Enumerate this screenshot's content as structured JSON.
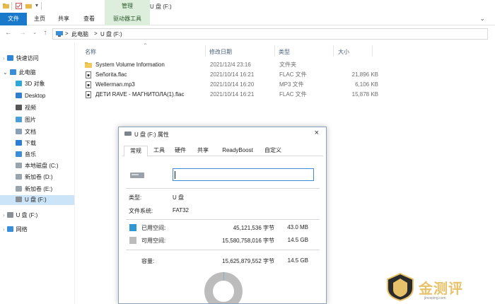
{
  "window": {
    "title": "U 盘 (F:)"
  },
  "ribbon": {
    "contextual_tab": "管理",
    "tabs": [
      {
        "label": "文件"
      },
      {
        "label": "主页"
      },
      {
        "label": "共享"
      },
      {
        "label": "查看"
      },
      {
        "label": "驱动器工具"
      }
    ]
  },
  "address": {
    "path": [
      "此电脑",
      "U 盘 (F:)"
    ],
    "separator": ">"
  },
  "nav_pane": {
    "items": [
      {
        "label": "快速访问",
        "icon": "star-icon"
      },
      {
        "label": "此电脑",
        "icon": "computer-icon"
      },
      {
        "label": "3D 对象",
        "icon": "cube-icon"
      },
      {
        "label": "Desktop",
        "icon": "desktop-icon"
      },
      {
        "label": "视频",
        "icon": "video-icon"
      },
      {
        "label": "图片",
        "icon": "picture-icon"
      },
      {
        "label": "文档",
        "icon": "document-icon"
      },
      {
        "label": "下载",
        "icon": "download-icon"
      },
      {
        "label": "音乐",
        "icon": "music-icon"
      },
      {
        "label": "本地磁盘 (C:)",
        "icon": "drive-icon"
      },
      {
        "label": "新加卷 (D:)",
        "icon": "drive-icon"
      },
      {
        "label": "新加卷 (E:)",
        "icon": "drive-icon"
      },
      {
        "label": "U 盘 (F:)",
        "icon": "usb-drive-icon"
      },
      {
        "label": "U 盘 (F:)",
        "icon": "usb-drive-icon"
      },
      {
        "label": "网络",
        "icon": "network-icon"
      }
    ],
    "selected_index": 12
  },
  "file_list": {
    "columns": [
      "名称",
      "修改日期",
      "类型",
      "大小"
    ],
    "rows": [
      {
        "name": "System Volume Information",
        "modified": "2021/12/4 23:16",
        "type": "文件夹",
        "size": "",
        "icon": "folder-icon"
      },
      {
        "name": "Señorita.flac",
        "modified": "2021/10/14 16:21",
        "type": "FLAC 文件",
        "size": "21,896 KB",
        "icon": "audio-file-icon"
      },
      {
        "name": "Wellerman.mp3",
        "modified": "2021/10/14 16:20",
        "type": "MP3 文件",
        "size": "6,106 KB",
        "icon": "audio-file-icon"
      },
      {
        "name": "ДЕТИ RAVE - МАГНИТОЛА(1).flac",
        "modified": "2021/10/14 16:21",
        "type": "FLAC 文件",
        "size": "15,878 KB",
        "icon": "audio-file-icon"
      }
    ]
  },
  "properties_dialog": {
    "title": "U 盘 (F:) 属性",
    "close": "×",
    "tabs": [
      "常规",
      "工具",
      "硬件",
      "共享",
      "ReadyBoost",
      "自定义"
    ],
    "active_tab": 0,
    "name_value": "",
    "type_label": "类型:",
    "type_value": "U 盘",
    "fs_label": "文件系统:",
    "fs_value": "FAT32",
    "used_label": "已用空间:",
    "used_bytes": "45,121,536 字节",
    "used_human": "43.0 MB",
    "free_label": "可用空间:",
    "free_bytes": "15,580,758,016 字节",
    "free_human": "14.5 GB",
    "capacity_label": "容量:",
    "capacity_bytes": "15,625,879,552 字节",
    "capacity_human": "14.5 GB",
    "used_fraction": 0.0029,
    "used_color": "#2f98d4",
    "free_color": "#bcbcbc"
  },
  "watermark": {
    "text": "金测评",
    "sub": "jinceping.com"
  }
}
